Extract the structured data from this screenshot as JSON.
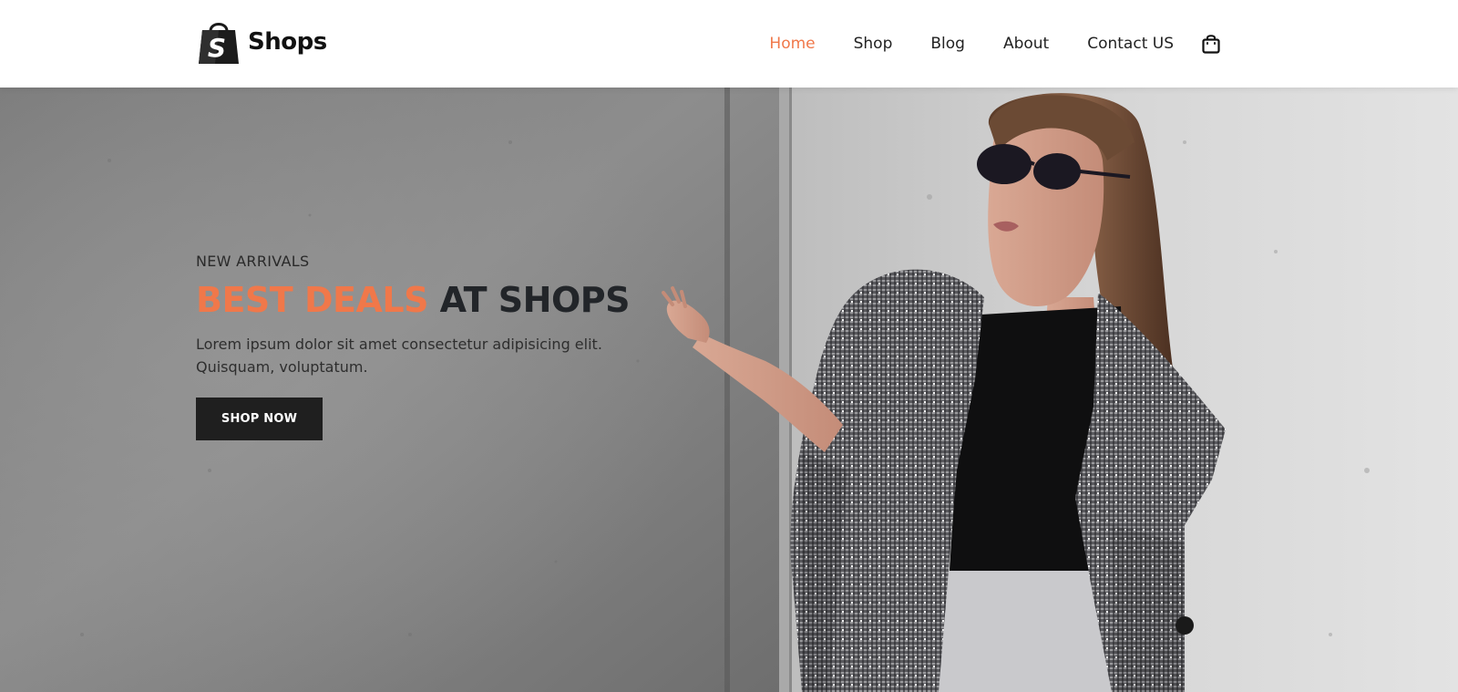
{
  "brand": {
    "name": "Shops",
    "icon": "shopping-bag-logo-icon"
  },
  "nav": {
    "items": [
      {
        "label": "Home",
        "active": true
      },
      {
        "label": "Shop",
        "active": false
      },
      {
        "label": "Blog",
        "active": false
      },
      {
        "label": "About",
        "active": false
      },
      {
        "label": "Contact US",
        "active": false
      }
    ],
    "cart_icon": "shopping-bag-icon"
  },
  "hero": {
    "eyebrow": "NEW ARRIVALS",
    "headline_accent": "BEST DEALS",
    "headline_rest": "AT SHOPS",
    "description": "Lorem ipsum dolor sit amet consectetur adipisicing elit. Quisquam, voluptatum.",
    "button_label": "SHOP NOW",
    "image": "woman-in-sunglasses-and-plaid-coat-against-concrete-wall"
  },
  "colors": {
    "accent": "#f0784a",
    "dark": "#1f1f1f",
    "header_bg": "#ffffff"
  }
}
